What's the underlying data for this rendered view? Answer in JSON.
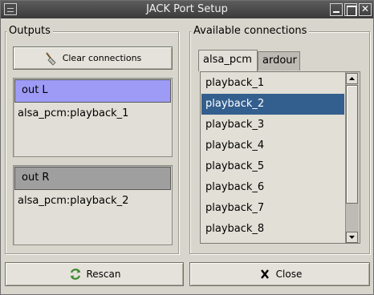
{
  "window": {
    "title": "JACK Port Setup",
    "minimize_icon": "minimize-icon",
    "maximize_icon": "maximize-icon",
    "close_icon": "close-icon"
  },
  "outputs": {
    "label": "Outputs",
    "clear_button_label": "Clear connections",
    "ports": [
      {
        "name": "out L",
        "connection": "alsa_pcm:playback_1",
        "selected": true,
        "header_color": "#9d9bf6"
      },
      {
        "name": "out R",
        "connection": "alsa_pcm:playback_2",
        "selected": false,
        "header_color": "#9f9f9f"
      }
    ]
  },
  "available": {
    "label": "Available connections",
    "tabs": [
      {
        "label": "alsa_pcm",
        "active": true
      },
      {
        "label": "ardour",
        "active": false
      }
    ],
    "items": [
      "playback_1",
      "playback_2",
      "playback_3",
      "playback_4",
      "playback_5",
      "playback_6",
      "playback_7",
      "playback_8"
    ],
    "selected_index": 1
  },
  "footer": {
    "rescan_label": "Rescan",
    "close_label": "Close"
  },
  "colors": {
    "selection": "#335f8e",
    "active_port_header": "#9d9bf6"
  }
}
